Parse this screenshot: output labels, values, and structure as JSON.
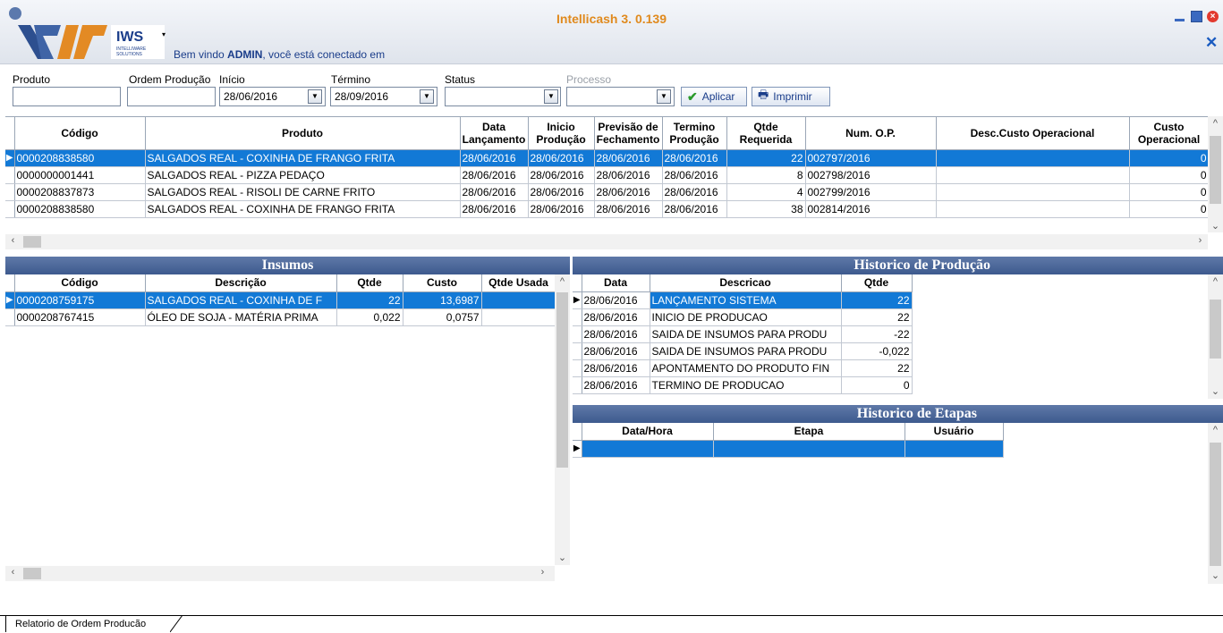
{
  "app": {
    "title": "Intellicash 3. 0.139",
    "logo_text": "IWS",
    "logo_sub": "INTELLIWARE SOLUTIONS",
    "welcome_prefix": "Bem vindo ",
    "welcome_user": "ADMIN",
    "welcome_suffix": ", você está conectado em"
  },
  "filters": {
    "produto_label": "Produto",
    "produto_value": "",
    "ordem_label": "Ordem Produção",
    "ordem_value": "",
    "inicio_label": "Início",
    "inicio_value": "28/06/2016",
    "termino_label": "Término",
    "termino_value": "28/09/2016",
    "status_label": "Status",
    "status_value": "",
    "processo_label": "Processo",
    "processo_value": "",
    "aplicar_label": "Aplicar",
    "imprimir_label": "Imprimir"
  },
  "orders": {
    "columns": [
      "Código",
      "Produto",
      "Data Lançamento",
      "Inicio Produção",
      "Previsão de Fechamento",
      "Termino Produção",
      "Qtde Requerida",
      "Num. O.P.",
      "Desc.Custo Operacional",
      "Custo Operacional"
    ],
    "rows": [
      {
        "codigo": "0000208838580",
        "produto": "SALGADOS REAL - COXINHA DE FRANGO FRITA",
        "lanc": "28/06/2016",
        "inicio": "28/06/2016",
        "prev": "28/06/2016",
        "term": "28/06/2016",
        "qtde": "22",
        "op": "002797/2016",
        "desc": "",
        "custo": "0"
      },
      {
        "codigo": "0000000001441",
        "produto": "SALGADOS REAL - PIZZA PEDAÇO",
        "lanc": "28/06/2016",
        "inicio": "28/06/2016",
        "prev": "28/06/2016",
        "term": "28/06/2016",
        "qtde": "8",
        "op": "002798/2016",
        "desc": "",
        "custo": "0"
      },
      {
        "codigo": "0000208837873",
        "produto": "SALGADOS REAL - RISOLI DE CARNE FRITO",
        "lanc": "28/06/2016",
        "inicio": "28/06/2016",
        "prev": "28/06/2016",
        "term": "28/06/2016",
        "qtde": "4",
        "op": "002799/2016",
        "desc": "",
        "custo": "0"
      },
      {
        "codigo": "0000208838580",
        "produto": "SALGADOS REAL - COXINHA DE FRANGO FRITA",
        "lanc": "28/06/2016",
        "inicio": "28/06/2016",
        "prev": "28/06/2016",
        "term": "28/06/2016",
        "qtde": "38",
        "op": "002814/2016",
        "desc": "",
        "custo": "0"
      }
    ]
  },
  "insumos": {
    "title": "Insumos",
    "columns": [
      "Código",
      "Descrição",
      "Qtde",
      "Custo",
      "Qtde Usada"
    ],
    "rows": [
      {
        "codigo": "0000208759175",
        "desc": "SALGADOS REAL - COXINHA DE F",
        "qtde": "22",
        "custo": "13,6987",
        "usada": ""
      },
      {
        "codigo": "0000208767415",
        "desc": "ÓLEO DE SOJA - MATÉRIA PRIMA",
        "qtde": "0,022",
        "custo": "0,0757",
        "usada": ""
      }
    ]
  },
  "historico": {
    "title": "Historico de Produção",
    "columns": [
      "Data",
      "Descricao",
      "Qtde"
    ],
    "rows": [
      {
        "data": "28/06/2016",
        "desc": "LANÇAMENTO SISTEMA",
        "qtde": "22"
      },
      {
        "data": "28/06/2016",
        "desc": "INICIO DE PRODUCAO",
        "qtde": "22"
      },
      {
        "data": "28/06/2016",
        "desc": "SAIDA DE INSUMOS PARA PRODU",
        "qtde": "-22"
      },
      {
        "data": "28/06/2016",
        "desc": "SAIDA DE INSUMOS PARA PRODU",
        "qtde": "-0,022"
      },
      {
        "data": "28/06/2016",
        "desc": "APONTAMENTO DO PRODUTO FIN",
        "qtde": "22"
      },
      {
        "data": "28/06/2016",
        "desc": "TERMINO DE PRODUCAO",
        "qtde": "0"
      }
    ]
  },
  "etapas": {
    "title": "Historico de Etapas",
    "columns": [
      "Data/Hora",
      "Etapa",
      "Usuário"
    ]
  },
  "status_tab": "Relatorio de Ordem Producão",
  "colors": {
    "selection": "#1279d6",
    "header_band": "#3d5a8e",
    "title_orange": "#e08a1e"
  }
}
